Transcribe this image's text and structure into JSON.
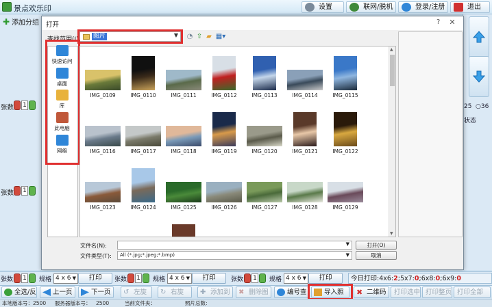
{
  "app": {
    "title": "景点欢乐印"
  },
  "topbar": {
    "settings": "设置",
    "network": "联网/脱机",
    "login": "登录/注册",
    "exit": "退出"
  },
  "sidebar": {
    "add_group": "添加分组"
  },
  "count_rows": [
    {
      "label": "张数",
      "value": "1"
    },
    {
      "label": "张数",
      "value": "1"
    }
  ],
  "right_panel": {
    "counter_a": "25",
    "counter_b": "36",
    "status_header": "状态"
  },
  "dialog": {
    "title": "打开",
    "help": "?",
    "close": "✕",
    "look_in_label": "查找范围(I):",
    "look_in_value": "图片",
    "places": [
      {
        "label": "快速访问",
        "icon": "star-icon",
        "color": "#2f86d8"
      },
      {
        "label": "桌面",
        "icon": "desktop-icon",
        "color": "#2f86d8"
      },
      {
        "label": "库",
        "icon": "library-icon",
        "color": "#e8b23c"
      },
      {
        "label": "此电脑",
        "icon": "computer-icon",
        "color": "#c0583a"
      },
      {
        "label": "网络",
        "icon": "network-icon",
        "color": "#2f86d8"
      }
    ],
    "files": [
      {
        "name": "IMG_0109",
        "orient": "land",
        "colors": [
          "#d9c26a",
          "#6a7a3a",
          "#3a4a2a"
        ]
      },
      {
        "name": "IMG_0110",
        "orient": "port",
        "colors": [
          "#101010",
          "#3a2a1a",
          "#c9a25a"
        ]
      },
      {
        "name": "IMG_0111",
        "orient": "land",
        "colors": [
          "#9fb9c9",
          "#5a6a4a",
          "#8a8a7a"
        ]
      },
      {
        "name": "IMG_0112",
        "orient": "port",
        "colors": [
          "#d8dfe6",
          "#c02020",
          "#3a6a2a"
        ]
      },
      {
        "name": "IMG_0113",
        "orient": "port",
        "colors": [
          "#3060b0",
          "#c4d6ea",
          "#1a2a4a"
        ]
      },
      {
        "name": "IMG_0114",
        "orient": "land",
        "colors": [
          "#8aa0b8",
          "#3a4a5a",
          "#c9c9c9"
        ]
      },
      {
        "name": "IMG_0115",
        "orient": "port",
        "colors": [
          "#3a78c8",
          "#8fb6e0",
          "#1a2a3a"
        ]
      },
      {
        "name": "IMG_0116",
        "orient": "land",
        "colors": [
          "#b9c2cc",
          "#6a7a8a",
          "#3a4a4a"
        ]
      },
      {
        "name": "IMG_0117",
        "orient": "land",
        "colors": [
          "#c4c8c8",
          "#7a7a6a",
          "#4a4a3a"
        ]
      },
      {
        "name": "IMG_0118",
        "orient": "land",
        "colors": [
          "#e0b89a",
          "#7a9ab8",
          "#3a4a6a"
        ]
      },
      {
        "name": "IMG_0119",
        "orient": "port",
        "colors": [
          "#1a2a4a",
          "#d89a4a",
          "#3a3a5a"
        ]
      },
      {
        "name": "IMG_0120",
        "orient": "land",
        "colors": [
          "#9a9a8a",
          "#5a5a4a",
          "#d8d8c8"
        ]
      },
      {
        "name": "IMG_0121",
        "orient": "port",
        "colors": [
          "#5a3a2a",
          "#e8c8a8",
          "#2a1a1a"
        ]
      },
      {
        "name": "IMG_0122",
        "orient": "port",
        "colors": [
          "#2a1a0a",
          "#d8a840",
          "#6a4a1a"
        ]
      },
      {
        "name": "IMG_0123",
        "orient": "land",
        "colors": [
          "#b8c8d8",
          "#8a5a3a",
          "#5a4a3a"
        ]
      },
      {
        "name": "IMG_0124",
        "orient": "port",
        "colors": [
          "#a8c8e8",
          "#7a6a5a",
          "#3a6a8a"
        ]
      },
      {
        "name": "IMG_0125",
        "orient": "land",
        "colors": [
          "#2a6a2a",
          "#4a8a3a",
          "#1a3a1a"
        ]
      },
      {
        "name": "IMG_0126",
        "orient": "land",
        "colors": [
          "#9ab0c0",
          "#8a8a7a",
          "#5a5a4a"
        ]
      },
      {
        "name": "IMG_0127",
        "orient": "land",
        "colors": [
          "#7a9a5a",
          "#4a6a3a",
          "#b8c8a8"
        ]
      },
      {
        "name": "IMG_0128",
        "orient": "land",
        "colors": [
          "#c8d8c8",
          "#5a7a4a",
          "#e8e8e0"
        ]
      },
      {
        "name": "IMG_0129",
        "orient": "land",
        "colors": [
          "#d8dfe6",
          "#6a4a5a",
          "#9a8a9a"
        ]
      },
      {
        "name": "",
        "orient": "land",
        "colors": [
          "#5a8a6a",
          "#9ab8c8",
          "#3a5a4a"
        ]
      },
      {
        "name": "",
        "orient": "land",
        "colors": [
          "#4a6a8a",
          "#8aa8c8",
          "#2a3a4a"
        ]
      },
      {
        "name": "",
        "orient": "port",
        "colors": [
          "#6a3a2a",
          "#d8b890",
          "#3a2a1a"
        ]
      },
      {
        "name": "",
        "orient": "land",
        "colors": [
          "#c8ccd0",
          "#8a9098",
          "#5a6068"
        ]
      },
      {
        "name": "",
        "orient": "land",
        "colors": [
          "#b8c8d8",
          "#6a7a8a",
          "#3a4a5a"
        ]
      },
      {
        "name": "",
        "orient": "land",
        "colors": [
          "#c8d0d8",
          "#9aa8b8",
          "#6a7888"
        ]
      }
    ],
    "filename_label": "文件名(N):",
    "filename_value": "",
    "filetype_label": "文件类型(T):",
    "filetype_value": "All (*.jpg;*.jpeg;*.bmp)",
    "open_button": "打开(O)",
    "cancel_button": "取消"
  },
  "print_row": {
    "groups": [
      {
        "count_label": "张数",
        "count": "1",
        "spec_label": "规格",
        "spec": "4 x 6",
        "print": "打印"
      },
      {
        "count_label": "张数",
        "count": "1",
        "spec_label": "规格",
        "spec": "4 x 6",
        "print": "打印"
      },
      {
        "count_label": "张数",
        "count": "1",
        "spec_label": "规格",
        "spec": "4 x 6",
        "print": "打印"
      }
    ],
    "today_label": "今日打印:4x6:",
    "today_4x6": "2",
    "today_5x7_label": ";5x7:",
    "today_5x7": "0",
    "today_6x8_label": ";6x8:",
    "today_6x8": "0",
    "today_6x9_label": ";6x9:",
    "today_6x9": "0"
  },
  "toolbar": {
    "select_all": "全选/反",
    "prev_page": "上一页",
    "next_page": "下一页",
    "rotate_left": "左旋",
    "rotate_right": "右旋",
    "add_to": "添加到",
    "delete": "删除图",
    "number_search": "编号查",
    "import_photo": "导入照",
    "qrcode": "二维码",
    "print_selected": "打印选中",
    "print_page": "打印整页",
    "print_all": "打印全部"
  },
  "status": {
    "local_version_label": "本地版本号：",
    "local_version": "2500",
    "server_version_label": "服务器版本号：",
    "server_version": "2500",
    "current_folder_label": "当前文件夹：",
    "photo_total_label": "照片总数:"
  }
}
